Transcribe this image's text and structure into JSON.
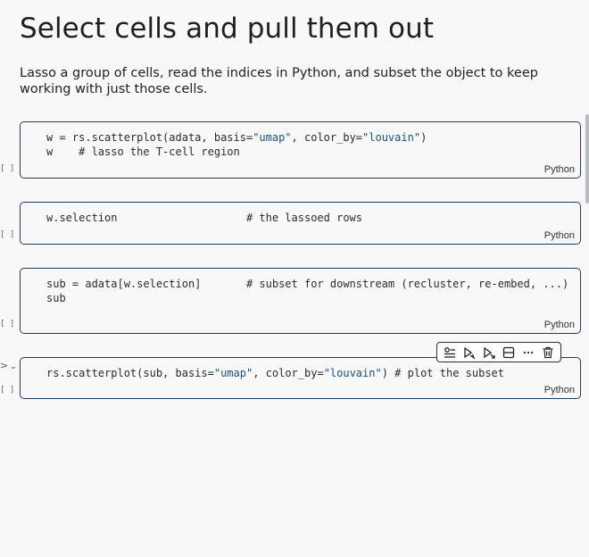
{
  "page": {
    "title": "Select cells and pull them out",
    "intro": "Lasso a group of cells, read the indices in Python, and subset the object to keep working with just those cells."
  },
  "cells": [
    {
      "exec": "[ ]",
      "lang": "Python",
      "lines": [
        [
          {
            "t": "w = rs.scatterplot(adata, basis=",
            "k": "code"
          },
          {
            "t": "\"umap\"",
            "k": "str"
          },
          {
            "t": ", color_by=",
            "k": "code"
          },
          {
            "t": "\"louvain\"",
            "k": "str"
          },
          {
            "t": ")",
            "k": "code"
          }
        ],
        [
          {
            "t": "w    # lasso the T-cell region",
            "k": "code"
          }
        ]
      ]
    },
    {
      "exec": "[ ]",
      "lang": "Python",
      "lines": [
        [
          {
            "t": "w.selection                    # the lassoed rows",
            "k": "code"
          }
        ]
      ]
    },
    {
      "exec": "[ ]",
      "lang": "Python",
      "lines": [
        [
          {
            "t": "sub = adata[w.selection]       # subset for downstream (recluster, re-embed, ...)",
            "k": "code"
          }
        ],
        [
          {
            "t": "sub",
            "k": "code"
          }
        ]
      ]
    },
    {
      "exec": "[ ]",
      "lang": "Python",
      "lines": [
        [
          {
            "t": "rs.scatterplot(sub, basis=",
            "k": "code"
          },
          {
            "t": "\"umap\"",
            "k": "str"
          },
          {
            "t": ", color_by=",
            "k": "code"
          },
          {
            "t": "\"louvain\"",
            "k": "str"
          },
          {
            "t": ") # plot the subset",
            "k": "code"
          }
        ]
      ]
    }
  ],
  "gutter": {
    "run_glyph": ">",
    "collapse_glyph": "⌄"
  },
  "toolbar": {
    "icons": [
      "settings-list-icon",
      "run-cell-icon",
      "run-below-icon",
      "split-cell-icon",
      "more-icon",
      "delete-icon"
    ]
  }
}
